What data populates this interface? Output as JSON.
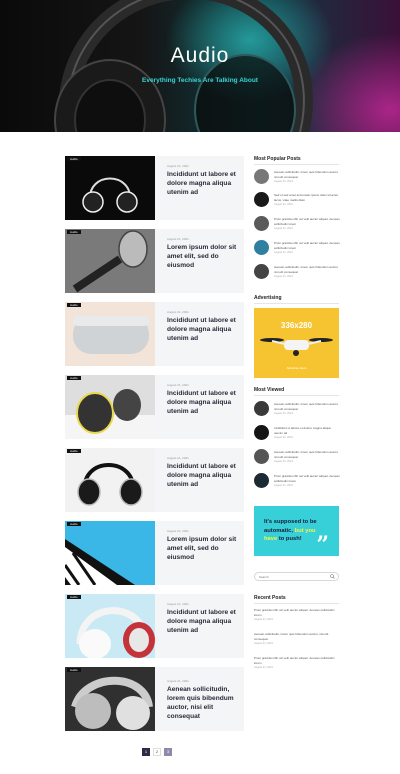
{
  "hero": {
    "title": "Audio",
    "subtitle": "Everything Techies Are Talking About"
  },
  "posts": [
    {
      "tag": "Audio",
      "date": "August 21, 2021",
      "title": "Incididunt ut labore et dolore magna aliqua utenim ad"
    },
    {
      "tag": "Audio",
      "date": "August 21, 2021",
      "title": "Lorem ipsum dolor sit amet elit, sed do eiusmod"
    },
    {
      "tag": "Audio",
      "date": "August 21, 2021",
      "title": "Incididunt ut labore et dolore magna aliqua utenim ad"
    },
    {
      "tag": "Audio",
      "date": "August 21, 2021",
      "title": "Incididunt ut labore et dolore magna aliqua utenim ad"
    },
    {
      "tag": "Audio",
      "date": "August 21, 2021",
      "title": "Incididunt ut labore et dolore magna aliqua utenim ad"
    },
    {
      "tag": "Audio",
      "date": "August 21, 2021",
      "title": "Lorem ipsum dolor sit amet elit, sed do eiusmod"
    },
    {
      "tag": "Audio",
      "date": "August 21, 2021",
      "title": "Incididunt ut labore et dolore magna aliqua utenim ad"
    },
    {
      "tag": "Audio",
      "date": "August 21, 2021",
      "title": "Aenean sollicitudin, lorem quis bibendum auctor, nisi elit consequat"
    }
  ],
  "sidebar": {
    "popular_heading": "Most Popular Posts",
    "popular": [
      {
        "title": "Aenean sollicitudin, lorem quis bibendum auctor, nisi elit consequat",
        "date": "August 21, 2021"
      },
      {
        "title": "Sed ut sed amet accumsan ipsum dolor sit amet lacus, vitae mattis diam",
        "date": "August 21, 2021"
      },
      {
        "title": "Proin gravida nibh vel velit auctor aliquet. Aenean sollicitudin lorem",
        "date": "August 21, 2021"
      },
      {
        "title": "Proin gravida nibh vel velit auctor aliquet. Aenean sollicitudin lorem",
        "date": "August 21, 2021"
      },
      {
        "title": "Aenean sollicitudin, lorem quis bibendum auctor, nisi elit consequat",
        "date": "August 21, 2021"
      }
    ],
    "ad_heading": "Advertising",
    "ad_size": "336x280",
    "ad_link": "Advertise Here",
    "viewed_heading": "Most Viewed",
    "viewed": [
      {
        "title": "Aenean sollicitudin, lorem quis bibendum auctor, nisi elit consequat",
        "date": "August 21, 2021"
      },
      {
        "title": "Incididunt ut labore et dolore magna aliqua utenim ad",
        "date": "August 21, 2021"
      },
      {
        "title": "Aenean sollicitudin, lorem quis bibendum auctor, nisi elit consequat",
        "date": "August 21, 2021"
      },
      {
        "title": "Proin gravida nibh vel velit auctor aliquet. Aenean sollicitudin lorem",
        "date": "August 21, 2021"
      }
    ],
    "quote_before": "It's supposed to be automatic, ",
    "quote_highlight": "but you have",
    "quote_after": " to push!",
    "quote_mark": "”",
    "search_placeholder": "Search",
    "recent_heading": "Recent Posts",
    "recent": [
      {
        "title": "Proin gravida nibh vel velit auctor aliquet. Aenean sollicitudin lorem",
        "date": "August 21, 2021"
      },
      {
        "title": "Aenean sollicitudin, lorem quis bibendum auctor, nisi elit consequat",
        "date": "August 21, 2021"
      },
      {
        "title": "Proin gravida nibh vel velit auctor aliquet. Aenean sollicitudin lorem",
        "date": "August 21, 2021"
      }
    ]
  },
  "pagination": [
    "1",
    "2",
    "3"
  ],
  "colors": {
    "accent": "#38d0d8",
    "ad_bg": "#f6c431",
    "hero_sub": "#3ad4d4"
  }
}
